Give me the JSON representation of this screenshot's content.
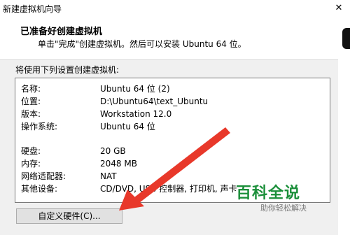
{
  "window": {
    "title": "新建虚拟机向导",
    "close_glyph": "✕"
  },
  "header": {
    "heading": "已准备好创建虚拟机",
    "subtitle": "单击\"完成\"创建虚拟机。然后可以安装 Ubuntu 64 位。"
  },
  "settings": {
    "label": "将使用下列设置创建虚拟机:",
    "rows": [
      {
        "key": "名称:",
        "value": "Ubuntu 64 位 (2)"
      },
      {
        "key": "位置:",
        "value": "D:\\Ubuntu64\\text_Ubuntu"
      },
      {
        "key": "版本:",
        "value": "Workstation 12.0"
      },
      {
        "key": "操作系统:",
        "value": "Ubuntu 64 位"
      },
      {
        "key": "硬盘:",
        "value": "20 GB"
      },
      {
        "key": "内存:",
        "value": "2048 MB"
      },
      {
        "key": "网络适配器:",
        "value": "NAT"
      },
      {
        "key": "其他设备:",
        "value": "CD/DVD, USB 控制器, 打印机, 声卡"
      }
    ]
  },
  "buttons": {
    "customize_hardware": "自定义硬件(C)..."
  },
  "watermark": {
    "brand": "百科全说",
    "tagline": "助你轻松解决"
  },
  "colors": {
    "arrow": "#e8382a",
    "watermark_green": "#1b8f3a"
  }
}
